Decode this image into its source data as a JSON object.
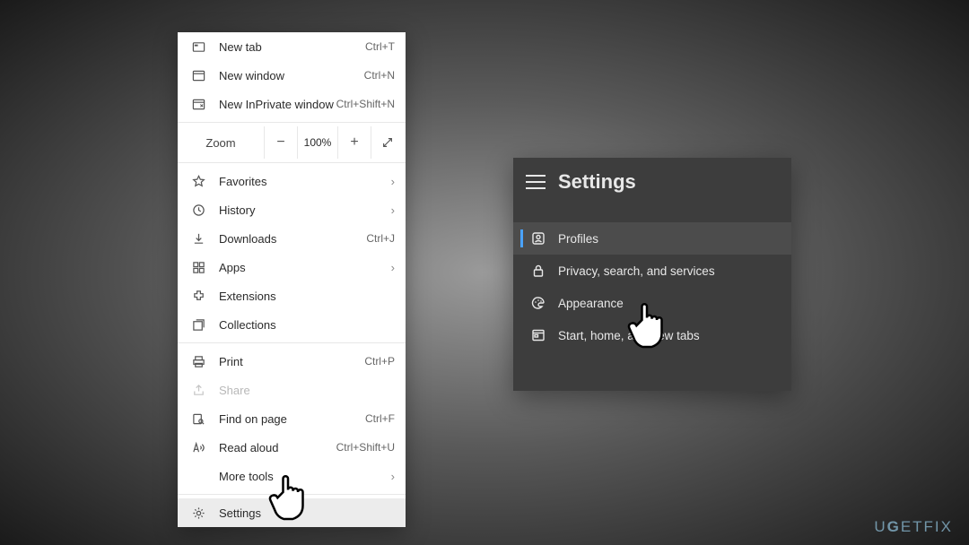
{
  "menu": {
    "new_tab": {
      "label": "New tab",
      "shortcut": "Ctrl+T"
    },
    "new_window": {
      "label": "New window",
      "shortcut": "Ctrl+N"
    },
    "new_inprivate": {
      "label": "New InPrivate window",
      "shortcut": "Ctrl+Shift+N"
    },
    "zoom": {
      "label": "Zoom",
      "value": "100%"
    },
    "favorites": {
      "label": "Favorites"
    },
    "history": {
      "label": "History"
    },
    "downloads": {
      "label": "Downloads",
      "shortcut": "Ctrl+J"
    },
    "apps": {
      "label": "Apps"
    },
    "extensions": {
      "label": "Extensions"
    },
    "collections": {
      "label": "Collections"
    },
    "print": {
      "label": "Print",
      "shortcut": "Ctrl+P"
    },
    "share": {
      "label": "Share"
    },
    "find": {
      "label": "Find on page",
      "shortcut": "Ctrl+F"
    },
    "read_aloud": {
      "label": "Read aloud",
      "shortcut": "Ctrl+Shift+U"
    },
    "more_tools": {
      "label": "More tools"
    },
    "settings": {
      "label": "Settings"
    }
  },
  "panel": {
    "title": "Settings",
    "items": {
      "profiles": "Profiles",
      "privacy": "Privacy, search, and services",
      "appearance": "Appearance",
      "start": "Start, home, and new tabs"
    }
  },
  "watermark": "UGETFIX"
}
